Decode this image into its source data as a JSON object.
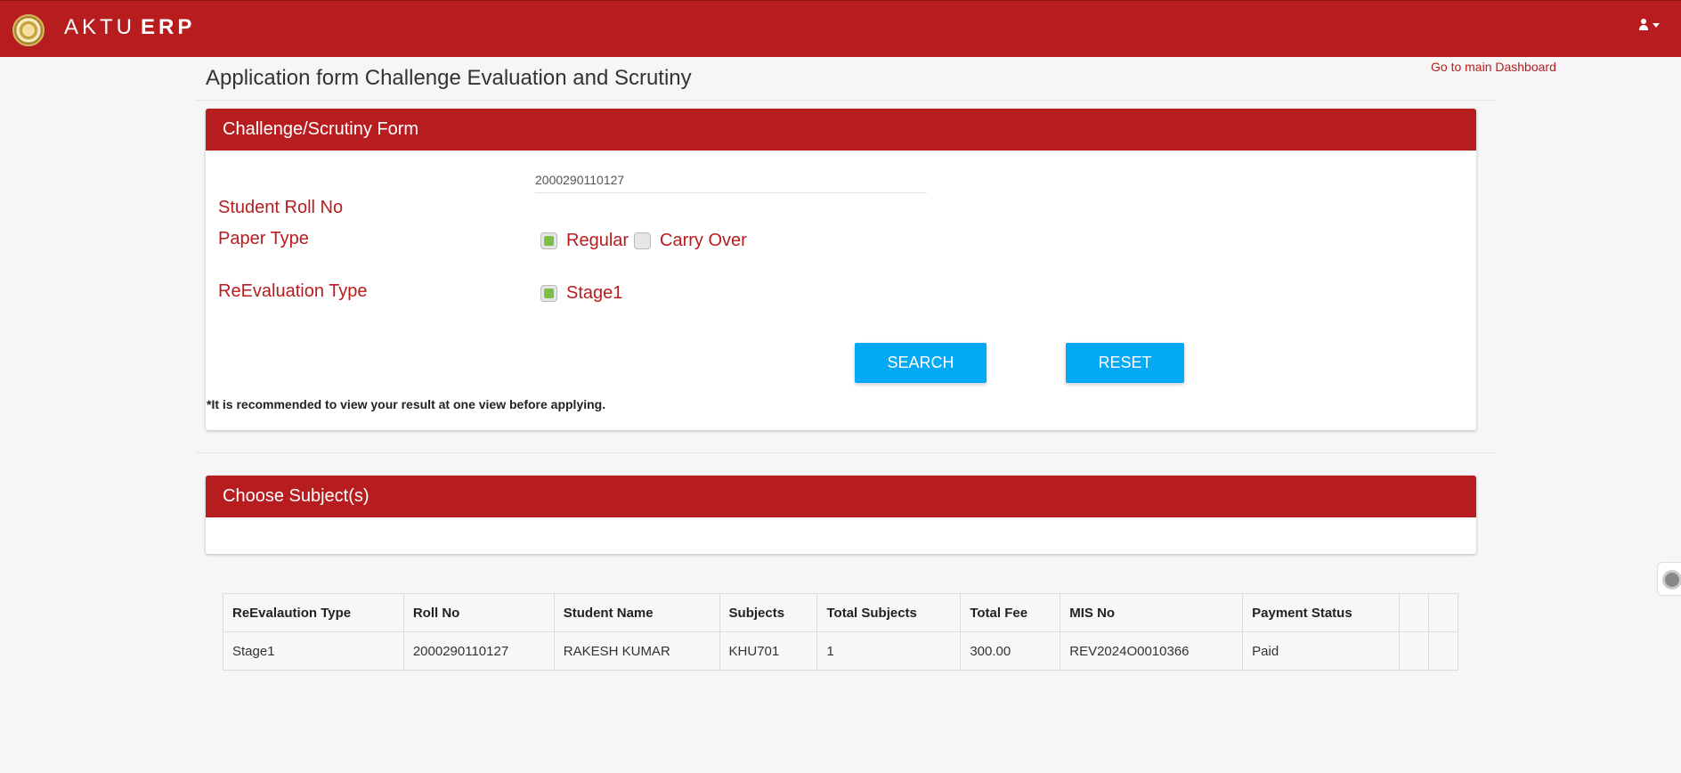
{
  "app": {
    "brand_light": "AKTU",
    "brand_bold": "ERP"
  },
  "colors": {
    "brand_red": "#b71c1f",
    "button_blue": "#03a9f4",
    "check_green": "#7ac143"
  },
  "header": {
    "title": "Application form Challenge Evaluation and Scrutiny",
    "dashboard_link": "Go to main Dashboard",
    "user_icon": "user-icon"
  },
  "form": {
    "card_title": "Challenge/Scrutiny Form",
    "roll_label": "Student Roll No",
    "roll_value": "2000290110127",
    "paper_type_label": "Paper Type",
    "paper_types": [
      {
        "label": "Regular",
        "checked": true
      },
      {
        "label": "Carry Over",
        "checked": false
      }
    ],
    "reeval_label": "ReEvaluation Type",
    "reeval_options": [
      {
        "label": "Stage1",
        "checked": true
      }
    ],
    "search_label": "SEARCH",
    "reset_label": "RESET",
    "note": "*It is recommended to view your result at one view before applying."
  },
  "subjects": {
    "card_title": "Choose Subject(s)"
  },
  "table": {
    "headers": [
      "ReEvalaution Type",
      "Roll No",
      "Student Name",
      "Subjects",
      "Total Subjects",
      "Total Fee",
      "MIS No",
      "Payment Status",
      "",
      ""
    ],
    "rows": [
      [
        "Stage1",
        "2000290110127",
        "RAKESH KUMAR",
        "KHU701",
        "1",
        "300.00",
        "REV2024O0010366",
        "Paid",
        "",
        ""
      ]
    ]
  }
}
